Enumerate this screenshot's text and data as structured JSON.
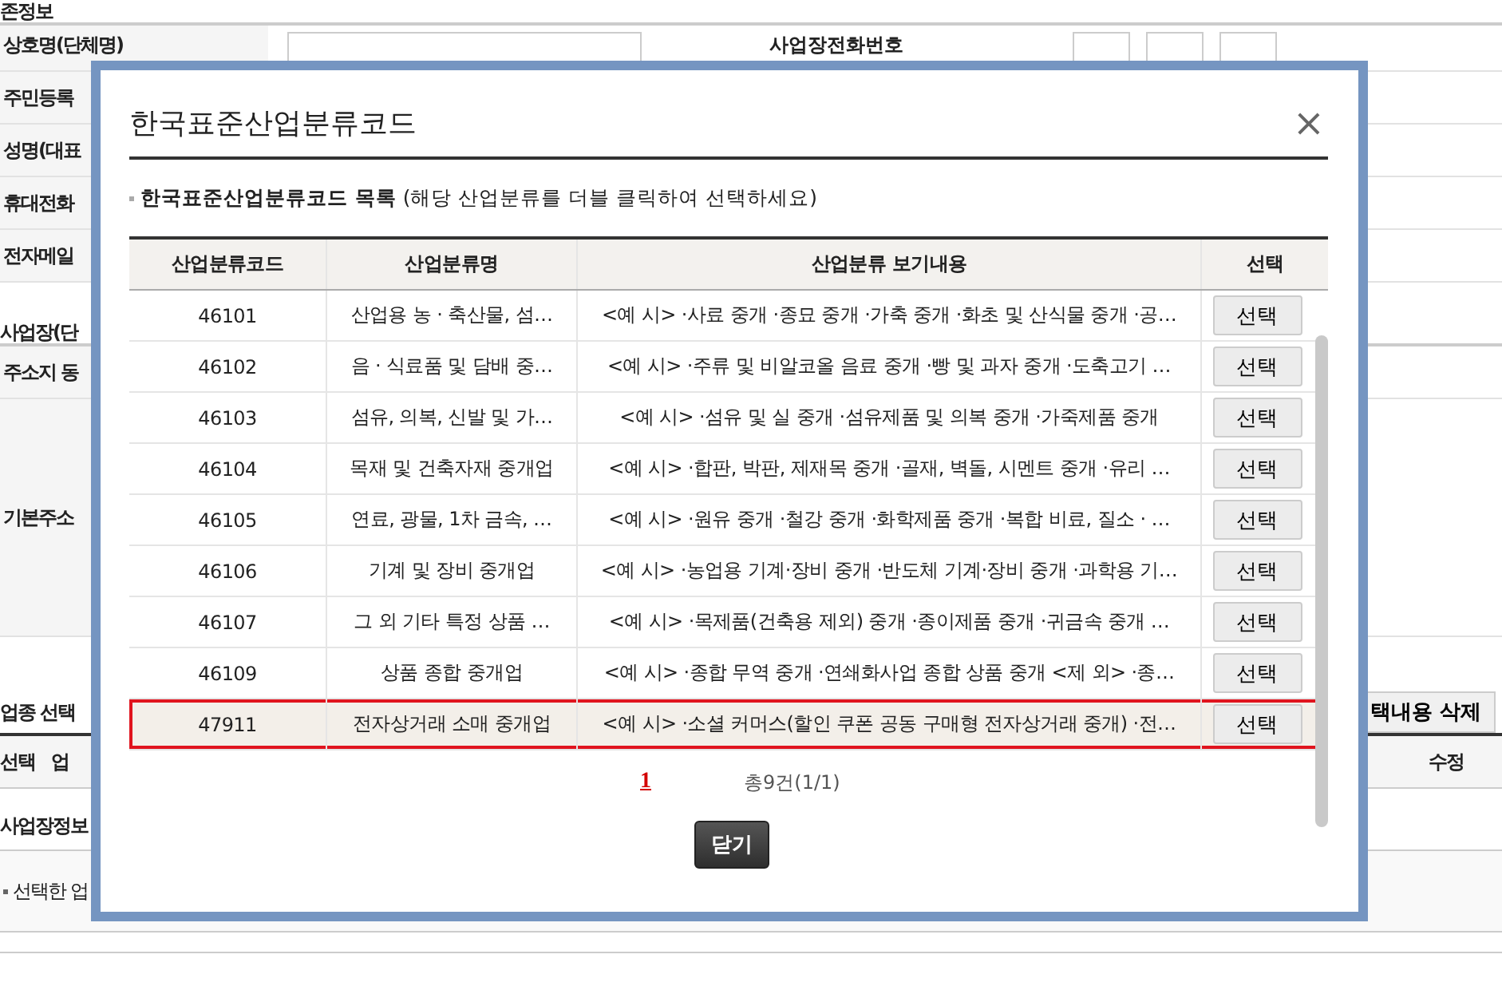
{
  "background": {
    "section_title": "존정보",
    "info_rows": [
      "상호명(단체명)",
      "주민등록",
      "성명(대표",
      "휴대전화",
      "전자메일"
    ],
    "phone_label": "사업장전화번호",
    "business_title": "사업장(단",
    "address_rows": [
      "주소지 동",
      "기본주소"
    ],
    "industry_title": "업종 선택",
    "delete_button": "택내용 삭제",
    "columns": [
      "선택",
      "업",
      "수정"
    ],
    "site_title": "사업장정보",
    "selected_note": "선택한 업"
  },
  "modal": {
    "title": "한국표준산업분류코드",
    "close": "×",
    "subtitle_bold": "한국표준산업분류코드 목록",
    "subtitle_note": "(해당 산업분류를 더블 클릭하여 선택하세요)",
    "columns": [
      "산업분류코드",
      "산업분류명",
      "산업분류 보기내용",
      "선택"
    ],
    "rows": [
      {
        "code": "46101",
        "name": "산업용 농 · 축산물, 섬…",
        "description": "<예 시> ·사료 중개 ·종묘 중개 ·가축 중개 ·화초 및 산식물 중개 ·공…",
        "button": "선택",
        "selected": false
      },
      {
        "code": "46102",
        "name": "음 · 식료품 및 담배 중…",
        "description": "<예 시> ·주류 및 비알코올 음료 중개 ·빵 및 과자 중개 ·도축고기 …",
        "button": "선택",
        "selected": false
      },
      {
        "code": "46103",
        "name": "섬유, 의복, 신발 및 가…",
        "description": "<예 시> ·섬유 및 실 중개 ·섬유제품 및 의복 중개 ·가죽제품 중개",
        "button": "선택",
        "selected": false
      },
      {
        "code": "46104",
        "name": "목재 및 건축자재 중개업",
        "description": "<예 시> ·합판, 박판, 제재목 중개 ·골재, 벽돌, 시멘트 중개 ·유리 …",
        "button": "선택",
        "selected": false
      },
      {
        "code": "46105",
        "name": "연료, 광물, 1차 금속, …",
        "description": "<예 시> ·원유 중개 ·철강 중개 ·화학제품 중개 ·복합 비료, 질소 · …",
        "button": "선택",
        "selected": false
      },
      {
        "code": "46106",
        "name": "기계 및 장비 중개업",
        "description": "<예 시> ·농업용 기계·장비 중개 ·반도체 기계·장비 중개 ·과학용 기…",
        "button": "선택",
        "selected": false
      },
      {
        "code": "46107",
        "name": "그 외 기타 특정 상품 …",
        "description": "<예 시> ·목제품(건축용 제외) 중개 ·종이제품 중개 ·귀금속 중개 …",
        "button": "선택",
        "selected": false
      },
      {
        "code": "46109",
        "name": "상품 종합 중개업",
        "description": "<예 시> ·종합 무역 중개 ·연쇄화사업 종합 상품 중개 <제 외> ·종…",
        "button": "선택",
        "selected": false
      },
      {
        "code": "47911",
        "name": "전자상거래 소매 중개업",
        "description": "<예 시> ·소셜 커머스(할인 쿠폰 공동 구매형 전자상거래 중개) ·전…",
        "button": "선택",
        "selected": true
      }
    ],
    "pager": {
      "page": "1",
      "total": "총9건(1/1)"
    },
    "close_button": "닫기"
  }
}
